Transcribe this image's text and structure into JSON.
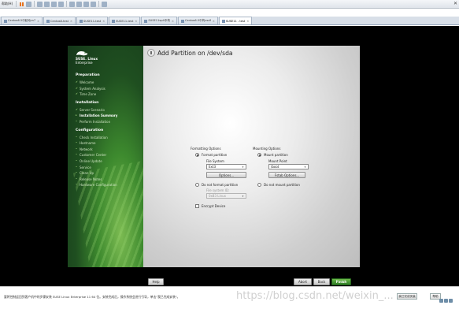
{
  "host": {
    "menu_label": "帮助(H)",
    "tabs": [
      {
        "label": "Centos6.5中起动cs7"
      },
      {
        "label": "Centos8-test"
      },
      {
        "label": "SUSE11-test"
      },
      {
        "label": "SUSE11-test"
      },
      {
        "label": "SUSE11sp4中构"
      },
      {
        "label": "Centos6.5中构vsdf"
      },
      {
        "label": "SUSE11 - test",
        "active": true
      }
    ],
    "status_text": "要将控制返回到客户机中的步骤安装 SUSE Linux Enterprise 11 64 位。安装完成后，操作系统会进行引导，单击\"我已完成安装\"。",
    "status_buttons": {
      "done": "我已完成安装",
      "help": "帮助"
    },
    "watermark": "https://blog.csdn.net/weixin_..."
  },
  "installer": {
    "brand": {
      "line1": "SUSE. Linux",
      "line2": "Enterprise"
    },
    "nav": {
      "preparation": {
        "title": "Preparation",
        "items": [
          "Welcome",
          "System Analysis",
          "Time Zone"
        ]
      },
      "installation": {
        "title": "Installation",
        "items": [
          "Server Scenario",
          "Installation Summary",
          "Perform Installation"
        ],
        "current_index": 1
      },
      "configuration": {
        "title": "Configuration",
        "items": [
          "Check Installation",
          "Hostname",
          "Network",
          "Customer Center",
          "Online Update",
          "Service",
          "Clean Up",
          "Release Notes",
          "Hardware Configuration"
        ]
      }
    },
    "page_title": "Add Partition on /dev/sda",
    "formatting": {
      "group_title": "Formatting Options",
      "format_radio": "Format partition",
      "fs_label": "File System",
      "fs_value": "Ext3",
      "options_button": "Options...",
      "no_format_radio": "Do not format partition",
      "fsid_label": "File system ID:",
      "fsid_value": "0x83 Linux",
      "encrypt_label": "Encrypt Device"
    },
    "mounting": {
      "group_title": "Mounting Options",
      "mount_radio": "Mount partition",
      "mount_point_label": "Mount Point",
      "mount_point_value": "/boot",
      "fstab_button": "Fstab Options...",
      "no_mount_radio": "Do not mount partition"
    },
    "buttons": {
      "help": "Help",
      "abort": "Abort",
      "back": "Back",
      "finish": "Finish"
    }
  }
}
